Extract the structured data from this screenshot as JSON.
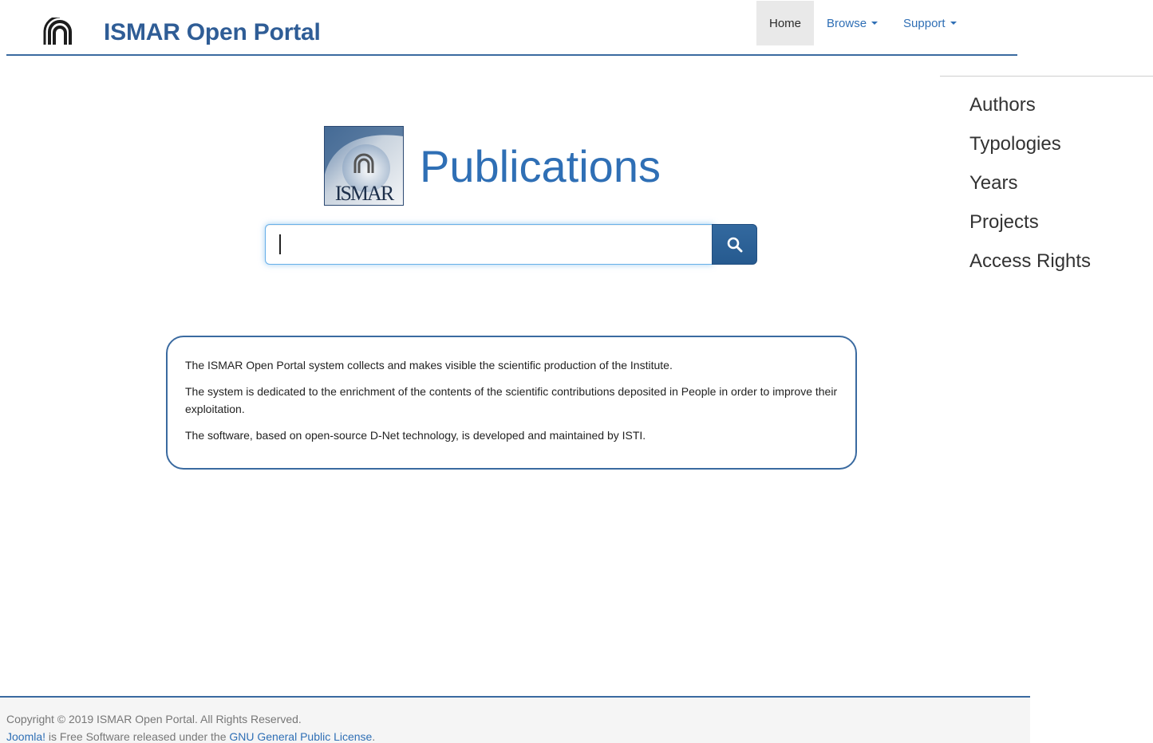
{
  "header": {
    "logo_icon": "cnr-logo-icon",
    "title": "ISMAR Open Portal"
  },
  "nav": {
    "home": "Home",
    "browse": "Browse",
    "support": "Support",
    "active": "Home"
  },
  "browse_menu": {
    "items": [
      "Authors",
      "Typologies",
      "Years",
      "Projects",
      "Access Rights"
    ]
  },
  "brand": {
    "logo_text": "ISMAR",
    "title": "Publications"
  },
  "search": {
    "value": "",
    "placeholder": "",
    "button_icon": "search-icon"
  },
  "info": {
    "paragraphs": [
      "The ISMAR Open Portal system collects and makes visible the scientific production of the Institute.",
      "The system is dedicated to the enrichment of the contents of the scientific contributions deposited in People in order to improve their exploitation.",
      "The software, based on open-source D-Net technology, is developed and maintained by ISTI."
    ]
  },
  "footer": {
    "copyright": "Copyright © 2019 ISMAR Open Portal. All Rights Reserved.",
    "joomla_link": "Joomla!",
    "middle_text": " is Free Software released under the ",
    "license_link": "GNU General Public License",
    "end": "."
  },
  "colors": {
    "brand_blue": "#2f5d96",
    "link_blue": "#2f6fb5",
    "rule_blue": "#3a6aa0",
    "search_button": "#265a8f"
  }
}
